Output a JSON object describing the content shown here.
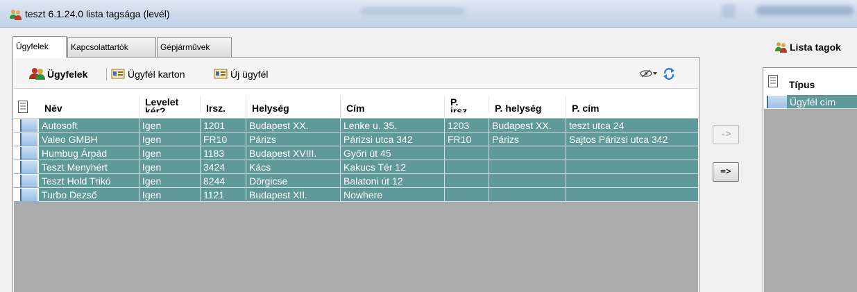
{
  "window": {
    "title": "teszt 6.1.24.0 lista tagsága (levél)"
  },
  "tabs": [
    {
      "label": "Ügyfelek",
      "active": true
    },
    {
      "label": "Kapcsolattartók",
      "active": false
    },
    {
      "label": "Gépjárművek",
      "active": false
    }
  ],
  "toolbar": {
    "title": "Ügyfelek",
    "card_label": "Ügyfél karton",
    "new_label": "Új ügyfél",
    "view_icon": "eye-dropdown-icon",
    "refresh_icon": "refresh-icon"
  },
  "grid": {
    "columns": [
      "Név",
      "Levelet kér?",
      "Irsz.",
      "Helység",
      "Cím",
      "P. irsz.",
      "P. helység",
      "P. cím"
    ],
    "column_display": [
      "Név",
      "Levelet\nkér?",
      "Irsz.",
      "Helység",
      "Cím",
      "P.\nirsz.",
      "P. helység",
      "P. cím"
    ],
    "rows": [
      [
        "Autosoft",
        "Igen",
        "1201",
        "Budapest XX.",
        "Lenke u. 35.",
        "1203",
        "Budapest XX.",
        "teszt utca 24"
      ],
      [
        "Valeo GMBH",
        "Igen",
        "FR10",
        "Párizs",
        "Párizsi utca 342",
        "FR10",
        "Párizs",
        "Sajtos Párizsi utca 342"
      ],
      [
        "Humbug Árpád",
        "Igen",
        "1183",
        "Budapest XVIII.",
        "Győri út 45",
        "",
        "",
        ""
      ],
      [
        "Teszt Menyhért",
        "Igen",
        "3424",
        "Kács",
        "Kakucs Tér 12",
        "",
        "",
        ""
      ],
      [
        "Teszt Hold Trikó",
        "Igen",
        "8244",
        "Dörgicse",
        "Balatoni út 12",
        "",
        "",
        ""
      ],
      [
        "Turbo Dezső",
        "Igen",
        "1121",
        "Budapest XII.",
        "Nowhere",
        "",
        "",
        ""
      ]
    ]
  },
  "buttons": {
    "add_one": "->",
    "add_all": "=>"
  },
  "right_panel": {
    "title": "Lista tagok",
    "column": "Típus",
    "rows": [
      "Ügyfél cím"
    ]
  },
  "colors": {
    "row_background": "#60999a",
    "row_text": "#ffffff",
    "grid_background": "#ababab"
  }
}
